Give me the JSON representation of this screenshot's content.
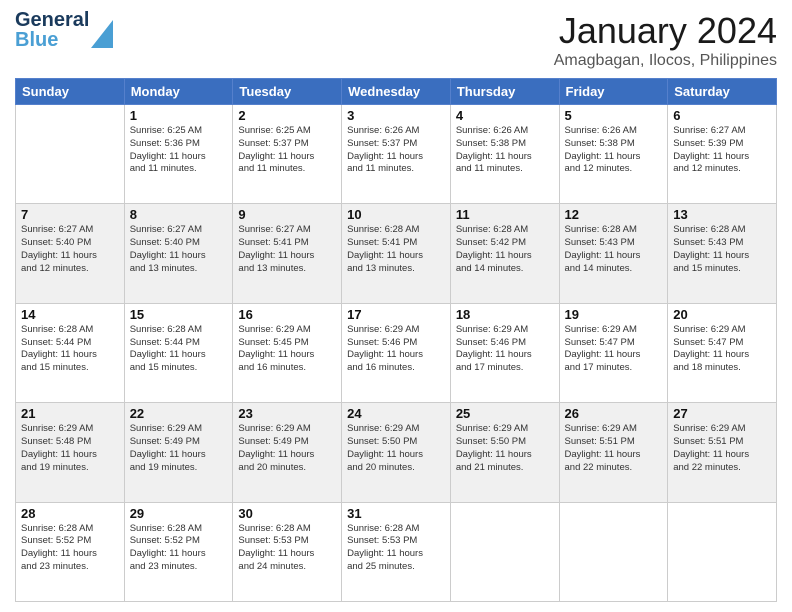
{
  "header": {
    "logo_line1": "General",
    "logo_line2": "Blue",
    "title": "January 2024",
    "location": "Amagbagan, Ilocos, Philippines"
  },
  "days_of_week": [
    "Sunday",
    "Monday",
    "Tuesday",
    "Wednesday",
    "Thursday",
    "Friday",
    "Saturday"
  ],
  "weeks": [
    [
      {
        "day": "",
        "info": ""
      },
      {
        "day": "1",
        "info": "Sunrise: 6:25 AM\nSunset: 5:36 PM\nDaylight: 11 hours\nand 11 minutes."
      },
      {
        "day": "2",
        "info": "Sunrise: 6:25 AM\nSunset: 5:37 PM\nDaylight: 11 hours\nand 11 minutes."
      },
      {
        "day": "3",
        "info": "Sunrise: 6:26 AM\nSunset: 5:37 PM\nDaylight: 11 hours\nand 11 minutes."
      },
      {
        "day": "4",
        "info": "Sunrise: 6:26 AM\nSunset: 5:38 PM\nDaylight: 11 hours\nand 11 minutes."
      },
      {
        "day": "5",
        "info": "Sunrise: 6:26 AM\nSunset: 5:38 PM\nDaylight: 11 hours\nand 12 minutes."
      },
      {
        "day": "6",
        "info": "Sunrise: 6:27 AM\nSunset: 5:39 PM\nDaylight: 11 hours\nand 12 minutes."
      }
    ],
    [
      {
        "day": "7",
        "info": "Sunrise: 6:27 AM\nSunset: 5:40 PM\nDaylight: 11 hours\nand 12 minutes."
      },
      {
        "day": "8",
        "info": "Sunrise: 6:27 AM\nSunset: 5:40 PM\nDaylight: 11 hours\nand 13 minutes."
      },
      {
        "day": "9",
        "info": "Sunrise: 6:27 AM\nSunset: 5:41 PM\nDaylight: 11 hours\nand 13 minutes."
      },
      {
        "day": "10",
        "info": "Sunrise: 6:28 AM\nSunset: 5:41 PM\nDaylight: 11 hours\nand 13 minutes."
      },
      {
        "day": "11",
        "info": "Sunrise: 6:28 AM\nSunset: 5:42 PM\nDaylight: 11 hours\nand 14 minutes."
      },
      {
        "day": "12",
        "info": "Sunrise: 6:28 AM\nSunset: 5:43 PM\nDaylight: 11 hours\nand 14 minutes."
      },
      {
        "day": "13",
        "info": "Sunrise: 6:28 AM\nSunset: 5:43 PM\nDaylight: 11 hours\nand 15 minutes."
      }
    ],
    [
      {
        "day": "14",
        "info": "Sunrise: 6:28 AM\nSunset: 5:44 PM\nDaylight: 11 hours\nand 15 minutes."
      },
      {
        "day": "15",
        "info": "Sunrise: 6:28 AM\nSunset: 5:44 PM\nDaylight: 11 hours\nand 15 minutes."
      },
      {
        "day": "16",
        "info": "Sunrise: 6:29 AM\nSunset: 5:45 PM\nDaylight: 11 hours\nand 16 minutes."
      },
      {
        "day": "17",
        "info": "Sunrise: 6:29 AM\nSunset: 5:46 PM\nDaylight: 11 hours\nand 16 minutes."
      },
      {
        "day": "18",
        "info": "Sunrise: 6:29 AM\nSunset: 5:46 PM\nDaylight: 11 hours\nand 17 minutes."
      },
      {
        "day": "19",
        "info": "Sunrise: 6:29 AM\nSunset: 5:47 PM\nDaylight: 11 hours\nand 17 minutes."
      },
      {
        "day": "20",
        "info": "Sunrise: 6:29 AM\nSunset: 5:47 PM\nDaylight: 11 hours\nand 18 minutes."
      }
    ],
    [
      {
        "day": "21",
        "info": "Sunrise: 6:29 AM\nSunset: 5:48 PM\nDaylight: 11 hours\nand 19 minutes."
      },
      {
        "day": "22",
        "info": "Sunrise: 6:29 AM\nSunset: 5:49 PM\nDaylight: 11 hours\nand 19 minutes."
      },
      {
        "day": "23",
        "info": "Sunrise: 6:29 AM\nSunset: 5:49 PM\nDaylight: 11 hours\nand 20 minutes."
      },
      {
        "day": "24",
        "info": "Sunrise: 6:29 AM\nSunset: 5:50 PM\nDaylight: 11 hours\nand 20 minutes."
      },
      {
        "day": "25",
        "info": "Sunrise: 6:29 AM\nSunset: 5:50 PM\nDaylight: 11 hours\nand 21 minutes."
      },
      {
        "day": "26",
        "info": "Sunrise: 6:29 AM\nSunset: 5:51 PM\nDaylight: 11 hours\nand 22 minutes."
      },
      {
        "day": "27",
        "info": "Sunrise: 6:29 AM\nSunset: 5:51 PM\nDaylight: 11 hours\nand 22 minutes."
      }
    ],
    [
      {
        "day": "28",
        "info": "Sunrise: 6:28 AM\nSunset: 5:52 PM\nDaylight: 11 hours\nand 23 minutes."
      },
      {
        "day": "29",
        "info": "Sunrise: 6:28 AM\nSunset: 5:52 PM\nDaylight: 11 hours\nand 23 minutes."
      },
      {
        "day": "30",
        "info": "Sunrise: 6:28 AM\nSunset: 5:53 PM\nDaylight: 11 hours\nand 24 minutes."
      },
      {
        "day": "31",
        "info": "Sunrise: 6:28 AM\nSunset: 5:53 PM\nDaylight: 11 hours\nand 25 minutes."
      },
      {
        "day": "",
        "info": ""
      },
      {
        "day": "",
        "info": ""
      },
      {
        "day": "",
        "info": ""
      }
    ]
  ]
}
